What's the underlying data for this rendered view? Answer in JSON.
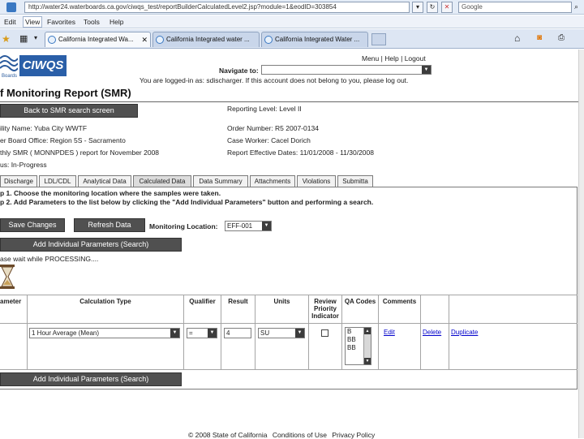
{
  "browser": {
    "url": "http://water24.waterboards.ca.gov/ciwqs_test/reportBuilderCalculatedLevel2.jsp?module=1&eodID=303854",
    "search_placeholder": "Google",
    "menu": [
      "Edit",
      "View",
      "Favorites",
      "Tools",
      "Help"
    ],
    "tabs": [
      {
        "label": "California Integrated Wa...",
        "active": true
      },
      {
        "label": "California Integrated water ...",
        "active": false
      },
      {
        "label": "California Integrated Water ...",
        "active": false
      }
    ]
  },
  "header": {
    "logo_small": "Boards",
    "logo_text": "CIWQS",
    "top_links": [
      "Menu",
      "|",
      "Help",
      "|",
      "Logout"
    ],
    "navigate_label": "Navigate to:",
    "logged_in_msg": "You are logged-in as: sdischarger. If this account does not belong to you, please log out."
  },
  "page": {
    "title": "f Monitoring Report (SMR)",
    "back_button": "Back to SMR search screen",
    "reporting_level": "Reporting Level: Level II",
    "facility_name": "ility Name: Yuba City WWTF",
    "order_number": "Order Number: R5 2007-0134",
    "board_office": "er Board Office: Region 5S - Sacramento",
    "case_worker": "Case Worker: Cacel Dorich",
    "smr_desc": "thly SMR ( MONNPDES ) report for November 2008",
    "effective_dates": "Report Effective Dates: 11/01/2008 - 11/30/2008",
    "status": "us: In-Progress"
  },
  "report_tabs": [
    "Discharge",
    "LDL/CDL",
    "Analytical Data",
    "Calculated Data",
    "Data Summary",
    "Attachments",
    "Violations",
    "Submitta"
  ],
  "instructions": {
    "step1": "p 1. Choose the monitoring location where the samples were taken.",
    "step2": "p 2. Add Parameters to the list below by clicking the \"Add Individual Parameters\" button and performing a search."
  },
  "toolbar": {
    "save_label": "Save Changes",
    "refresh_label": "Refresh Data",
    "monitoring_location_label": "Monitoring Location:",
    "monitoring_location_value": "EFF-001",
    "add_params_label": "Add Individual Parameters (Search)",
    "processing_msg": "ase wait while PROCESSING....",
    "add_params_bottom_label": "Add Individual Parameters (Search)"
  },
  "table": {
    "headers": [
      "ameter",
      "Calculation Type",
      "Qualifier",
      "Result",
      "Units",
      "Review Priority Indicator",
      "QA Codes",
      "Comments"
    ],
    "row": {
      "calc_type": "1 Hour Average (Mean)",
      "qualifier": "=",
      "result": "4",
      "units": "SU",
      "qa_codes": [
        "B",
        "BB",
        "BB"
      ],
      "edit": "Edit",
      "delete": "Delete",
      "duplicate": "Duplicate"
    }
  },
  "footer": {
    "copyright": "© 2008 State of California",
    "conditions": "Conditions of Use",
    "privacy": "Privacy Policy"
  },
  "colors": {
    "dark_button": "#505050",
    "link": "#0000cc"
  }
}
